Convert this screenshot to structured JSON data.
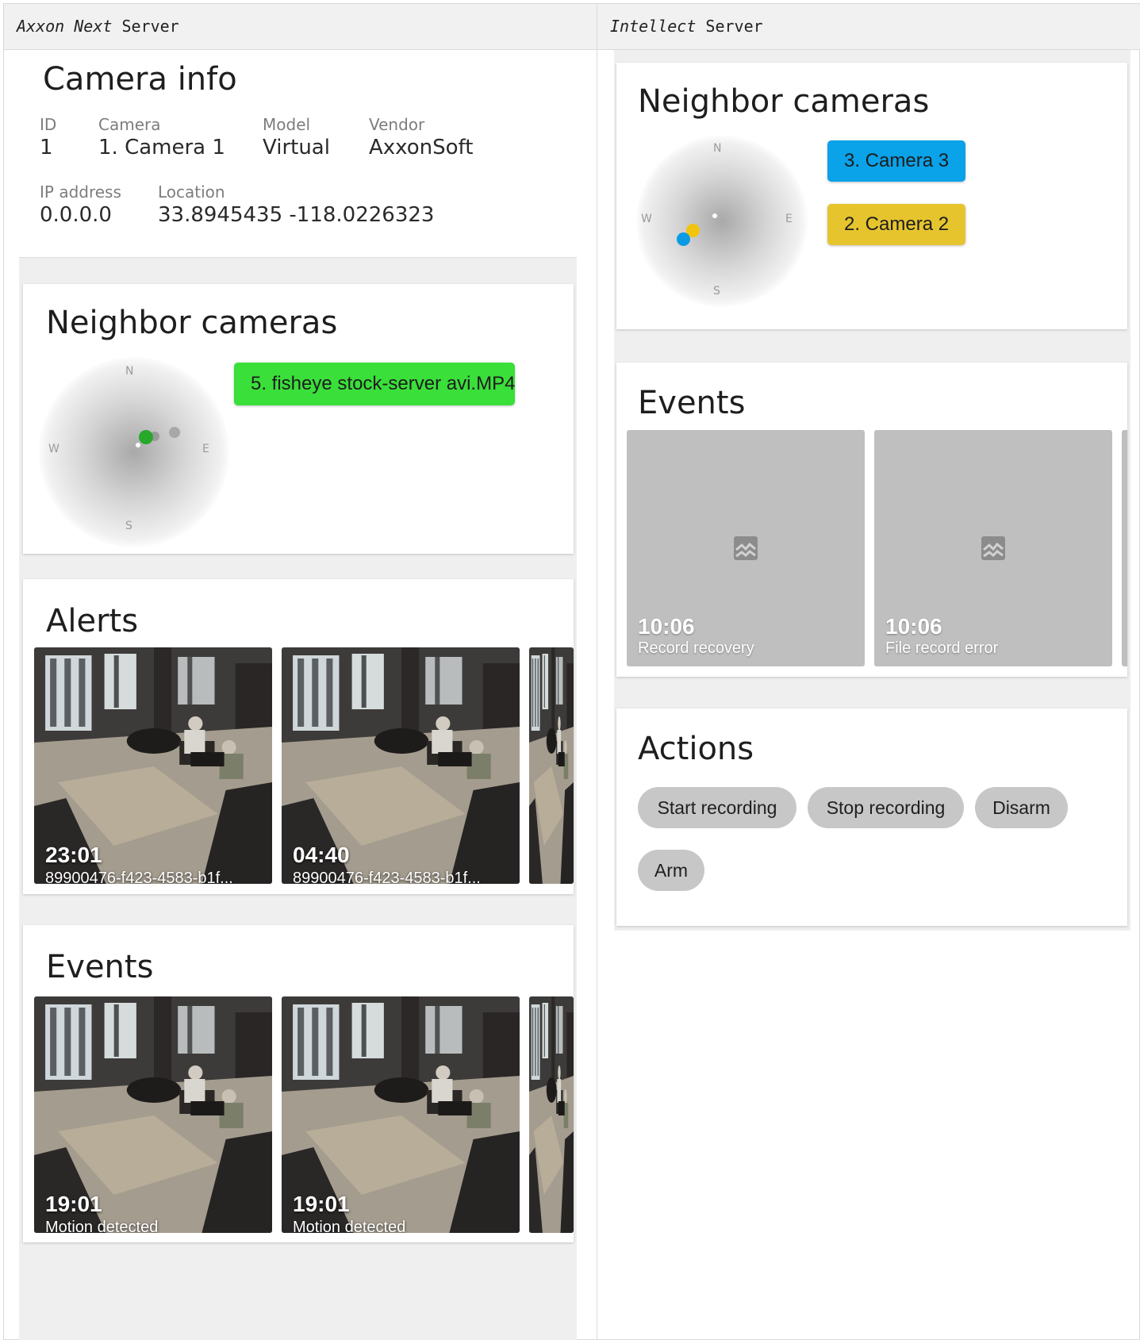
{
  "columns": {
    "left_header_italic": "Axxon Next",
    "left_header_rest": " Server",
    "right_header_italic": "Intellect",
    "right_header_rest": " Server"
  },
  "axxon": {
    "camera_info": {
      "title": "Camera info",
      "id_label": "ID",
      "id_value": "1",
      "camera_label": "Camera",
      "camera_value": "1. Camera 1",
      "model_label": "Model",
      "model_value": "Virtual",
      "vendor_label": "Vendor",
      "vendor_value": "AxxonSoft",
      "ip_label": "IP address",
      "ip_value": "0.0.0.0",
      "location_label": "Location",
      "location_value": "33.8945435 -118.0226323"
    },
    "neighbors": {
      "title": "Neighbor cameras",
      "dir_n": "N",
      "dir_s": "S",
      "dir_w": "W",
      "dir_e": "E",
      "camera_button": "5. fisheye stock-server avi.MP4",
      "camera_button_color": "#3adf3a"
    },
    "alerts": {
      "title": "Alerts",
      "items": [
        {
          "time": "23:01",
          "subtitle": "89900476-f423-4583-b1f..."
        },
        {
          "time": "04:40",
          "subtitle": "89900476-f423-4583-b1f..."
        }
      ]
    },
    "events": {
      "title": "Events",
      "items": [
        {
          "time": "19:01",
          "subtitle": "Motion detected"
        },
        {
          "time": "19:01",
          "subtitle": "Motion detected"
        }
      ]
    }
  },
  "intellect": {
    "neighbors": {
      "title": "Neighbor cameras",
      "dir_n": "N",
      "dir_s": "S",
      "dir_w": "W",
      "dir_e": "E",
      "buttons": [
        {
          "label": "3. Camera 3",
          "color": "#0aa2e8"
        },
        {
          "label": "2. Camera 2",
          "color": "#e6c42e"
        }
      ]
    },
    "events": {
      "title": "Events",
      "items": [
        {
          "time": "10:06",
          "subtitle": "Record recovery",
          "icon": "broken-image-icon"
        },
        {
          "time": "10:06",
          "subtitle": "File record error",
          "icon": "broken-image-icon"
        }
      ]
    },
    "actions": {
      "title": "Actions",
      "items": [
        "Start recording",
        "Stop recording",
        "Disarm",
        "Arm"
      ]
    }
  }
}
